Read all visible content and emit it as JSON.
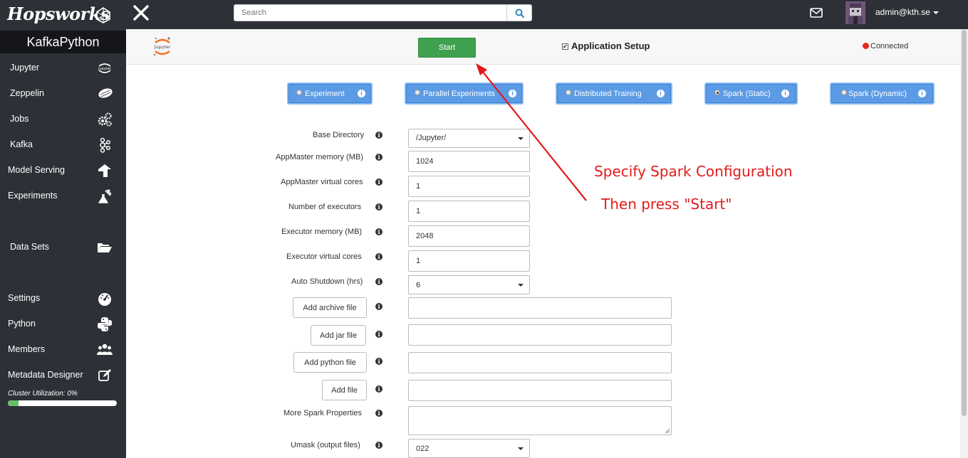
{
  "topbar": {
    "logo": "Hopsworks",
    "search_placeholder": "Search",
    "user": "admin@kth.se"
  },
  "sidebar": {
    "project": "KafkaPython",
    "items": [
      {
        "label": "Jupyter",
        "icon": "jupyter-icon"
      },
      {
        "label": "Zeppelin",
        "icon": "zeppelin-icon"
      },
      {
        "label": "Jobs",
        "icon": "gears-icon"
      },
      {
        "label": "Kafka",
        "icon": "kafka-icon"
      },
      {
        "label": "Model Serving",
        "icon": "serving-icon"
      },
      {
        "label": "Experiments",
        "icon": "flask-icon"
      },
      {
        "label": "Data Sets",
        "icon": "folder-open-icon"
      },
      {
        "label": "Settings",
        "icon": "dashboard-icon"
      },
      {
        "label": "Python",
        "icon": "python-icon"
      },
      {
        "label": "Members",
        "icon": "users-icon"
      },
      {
        "label": "Metadata Designer",
        "icon": "edit-icon"
      }
    ],
    "cluster_utilization": "Cluster Utilization: 0%",
    "cluster_utilization_value": 0.1
  },
  "header": {
    "jupyter_logo_text": "jupyter",
    "start_label": "Start",
    "app_setup_label": "Application Setup",
    "app_setup_checked": "✔",
    "status": "Connected",
    "status_color": "#e32b1e"
  },
  "modes": [
    {
      "label": "Experiment",
      "selected": false
    },
    {
      "label": "Parallel Experiments",
      "selected": false
    },
    {
      "label": "Distributed Training",
      "selected": false
    },
    {
      "label": "Spark (Static)",
      "selected": true
    },
    {
      "label": "Spark (Dynamic)",
      "selected": false
    }
  ],
  "form": {
    "base_dir_label": "Base Directory",
    "base_dir_value": "/Jupyter/",
    "am_mem_label": "AppMaster memory (MB)",
    "am_mem_value": "1024",
    "am_cores_label": "AppMaster virtual cores",
    "am_cores_value": "1",
    "num_exec_label": "Number of executors",
    "num_exec_value": "1",
    "exec_mem_label": "Executor memory (MB)",
    "exec_mem_value": "2048",
    "exec_cores_label": "Executor virtual cores",
    "exec_cores_value": "1",
    "shutdown_label": "Auto Shutdown (hrs)",
    "shutdown_value": "6",
    "add_archive": "Add archive file",
    "add_jar": "Add jar file",
    "add_python": "Add python file",
    "add_file": "Add file",
    "more_props_label": "More Spark Properties",
    "umask_label": "Umask (output files)",
    "umask_value": "022",
    "info_glyph": "i"
  },
  "annotation": {
    "line1": "Specify Spark Configuration",
    "line2": "Then press \"Start\"",
    "color": "#e31a1a"
  }
}
